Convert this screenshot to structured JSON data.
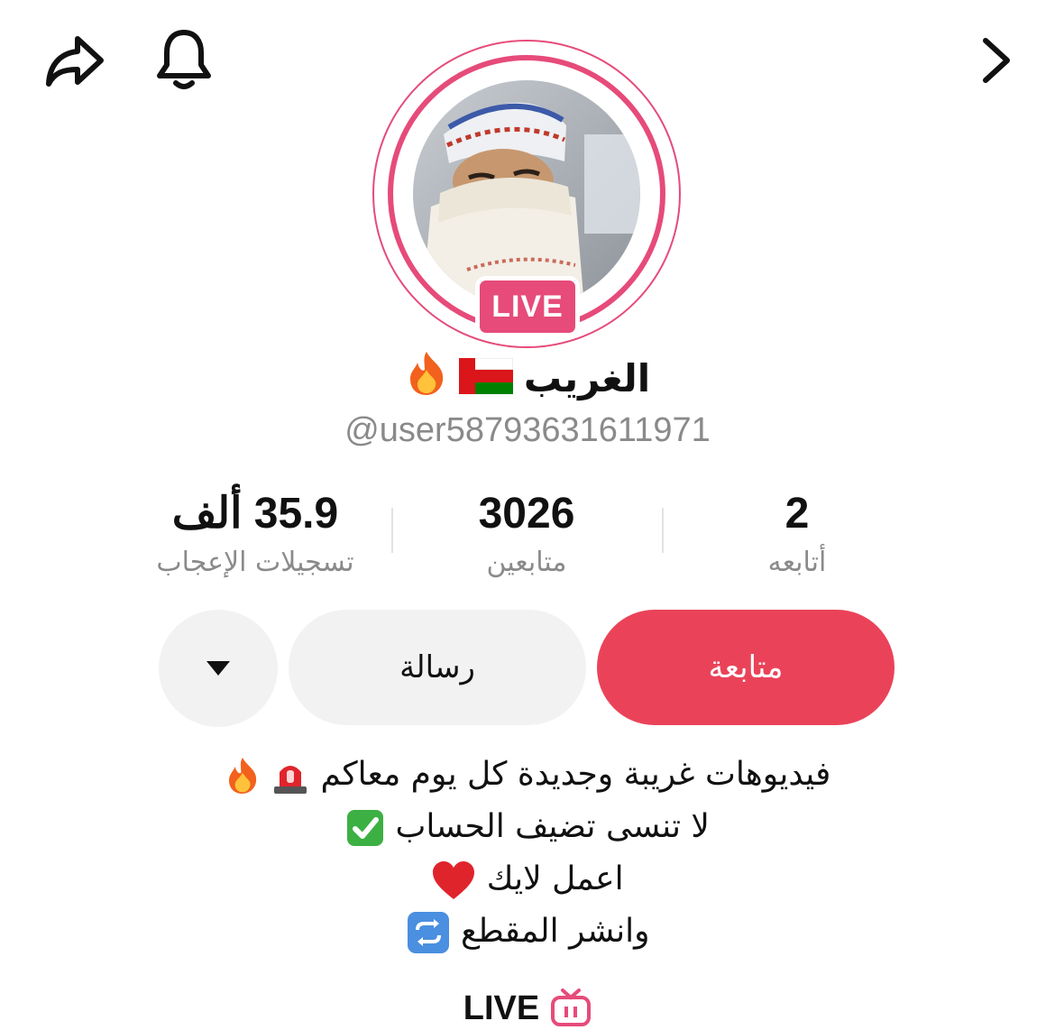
{
  "header": {
    "share_icon": "share-arrow-icon",
    "bell_icon": "bell-icon",
    "forward_icon": "chevron-right-icon"
  },
  "profile": {
    "live_badge": "LIVE",
    "display_name": "الغريب",
    "handle": "@user58793631611971",
    "accent_color": "#e64b7a"
  },
  "stats": {
    "following": {
      "value": "2",
      "label": "أتابعه"
    },
    "followers": {
      "value": "3026",
      "label": "متابعين"
    },
    "likes": {
      "value": "35.9 ألف",
      "label": "تسجيلات الإعجاب"
    }
  },
  "actions": {
    "follow_label": "متابعة",
    "message_label": "رسالة",
    "more_icon": "triangle-down-icon",
    "follow_color": "#ea4359"
  },
  "bio": {
    "line1": "فيديوهات غريبة وجديدة كل يوم معاكم",
    "line2": "لا تنسى تضيف الحساب",
    "line3": "اعمل لايك",
    "line4": "وانشر المقطع"
  },
  "live_link": {
    "label": "LIVE"
  }
}
